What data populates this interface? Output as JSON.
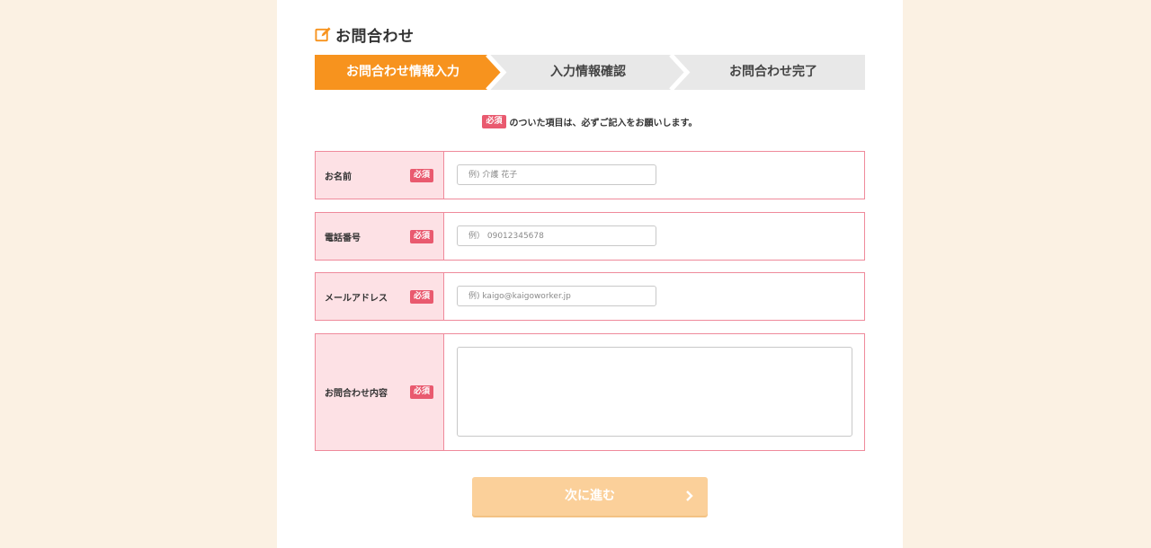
{
  "page": {
    "title": "お問合わせ",
    "icon": "edit-icon"
  },
  "steps": [
    {
      "label": "お問合わせ情報入力",
      "active": true
    },
    {
      "label": "入力情報確認",
      "active": false
    },
    {
      "label": "お問合わせ完了",
      "active": false
    }
  ],
  "notice": {
    "badge": "必須",
    "text": "のついた項目は、必ずご記入をお願いします。"
  },
  "form": {
    "name": {
      "label": "お名前",
      "badge": "必須",
      "placeholder": "例) 介護 花子",
      "value": ""
    },
    "phone": {
      "label": "電話番号",
      "badge": "必須",
      "placeholder": "例） 09012345678",
      "value": ""
    },
    "email": {
      "label": "メールアドレス",
      "badge": "必須",
      "placeholder": "例) kaigo@kaigoworker.jp",
      "value": ""
    },
    "message": {
      "label": "お問合わせ内容",
      "badge": "必須",
      "placeholder": "",
      "value": ""
    }
  },
  "submit": {
    "label": "次に進む",
    "icon": "chevron-right-icon"
  },
  "colors": {
    "background": "#fbf1e3",
    "accent": "#f7931e",
    "required": "#e95a6f",
    "row_border": "#ef8a9b",
    "label_bg": "#fde1e5",
    "button": "#fbd09a"
  }
}
